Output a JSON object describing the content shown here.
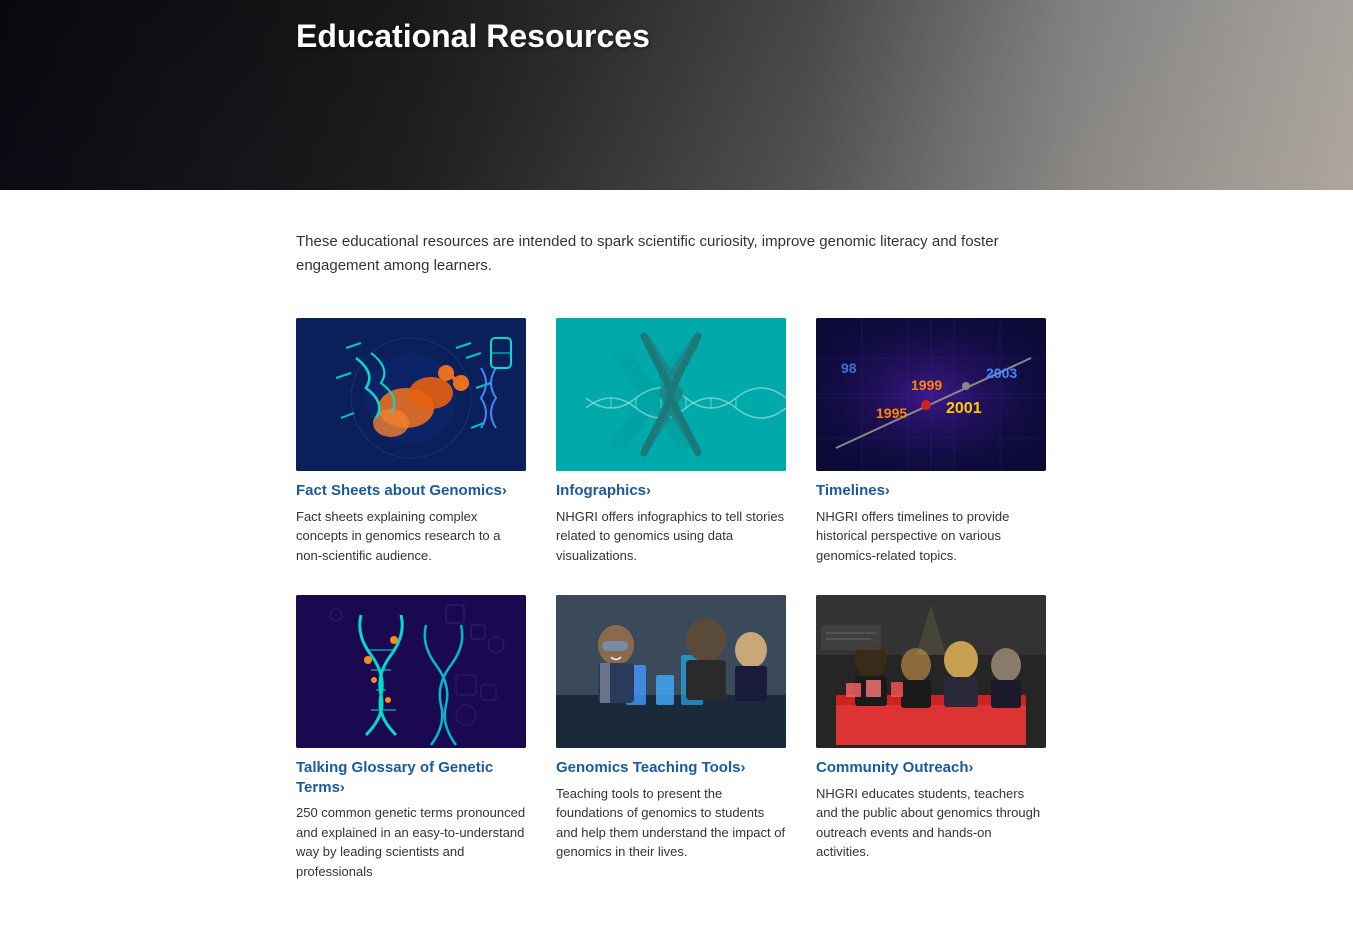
{
  "hero": {
    "title": "Educational Resources"
  },
  "intro": {
    "text": "These educational resources are intended to spark scientific curiosity, improve genomic literacy and foster engagement among learners."
  },
  "cards": [
    {
      "id": "fact-sheets",
      "title": "Fact Sheets about Genomics›",
      "description": "Fact sheets explaining complex concepts in genomics research to a non-scientific audience.",
      "image_type": "illustration_dna"
    },
    {
      "id": "infographics",
      "title": "Infographics›",
      "description": "NHGRI offers infographics to tell stories related to genomics using data visualizations.",
      "image_type": "illustration_chromosome"
    },
    {
      "id": "timelines",
      "title": "Timelines›",
      "description": "NHGRI offers timelines to provide historical perspective on various genomics-related topics.",
      "image_type": "illustration_timeline"
    },
    {
      "id": "glossary",
      "title": "Talking Glossary of Genetic Terms›",
      "description": "250 common genetic terms pronounced and explained in an easy-to-understand way by leading scientists and professionals",
      "image_type": "illustration_glossary"
    },
    {
      "id": "teaching-tools",
      "title": "Genomics Teaching Tools›",
      "description": "Teaching tools to present the foundations of genomics to students and help them understand the impact of genomics in their lives.",
      "image_type": "photo_kids"
    },
    {
      "id": "community-outreach",
      "title": "Community Outreach›",
      "description": "NHGRI educates students, teachers and the public about genomics through outreach events and hands-on activities.",
      "image_type": "photo_outreach"
    }
  ]
}
